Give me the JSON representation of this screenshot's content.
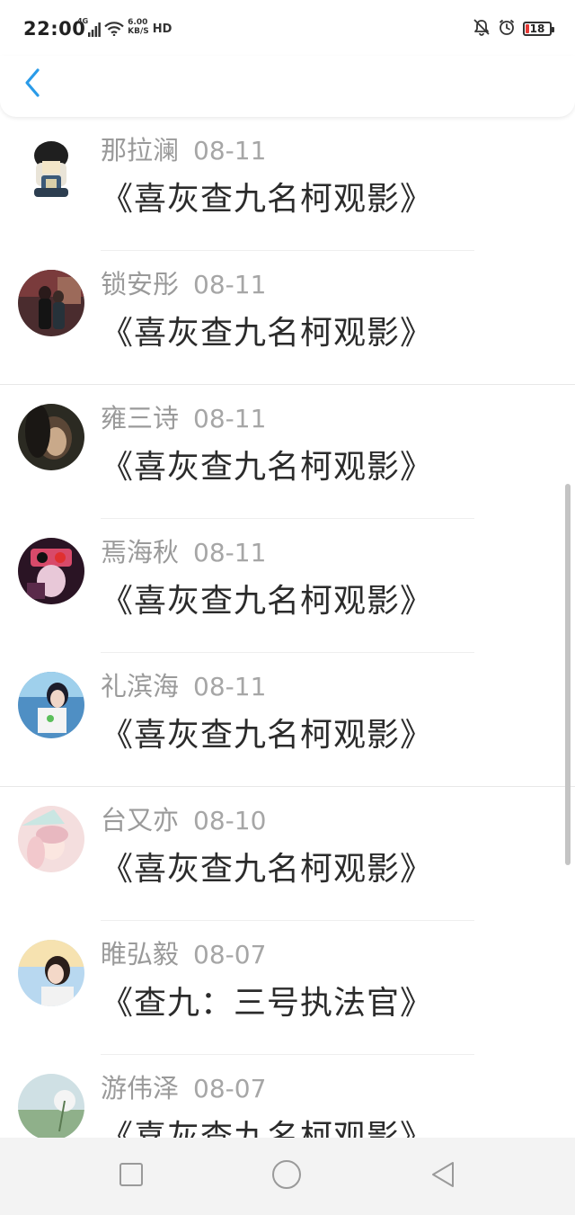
{
  "status_bar": {
    "time": "22:00",
    "network_type": "4G",
    "speed_value": "6.00",
    "speed_unit": "KB/S",
    "hd_label": "HD",
    "battery_level": "18",
    "icons": [
      "signal-icon",
      "wifi-icon",
      "bell-muted-icon",
      "alarm-clock-icon",
      "battery-icon"
    ],
    "battery_color": "#e53935"
  },
  "header": {
    "back_icon": "chevron-left-icon",
    "accent_color": "#2a9be8"
  },
  "list": {
    "items": [
      {
        "name": "那拉澜",
        "date": "08-11",
        "title": "《喜灰查九名柯观影》"
      },
      {
        "name": "锁安彤",
        "date": "08-11",
        "title": "《喜灰查九名柯观影》"
      },
      {
        "name": "雍三诗",
        "date": "08-11",
        "title": "《喜灰查九名柯观影》"
      },
      {
        "name": "焉海秋",
        "date": "08-11",
        "title": "《喜灰查九名柯观影》"
      },
      {
        "name": "礼滨海",
        "date": "08-11",
        "title": "《喜灰查九名柯观影》"
      },
      {
        "name": "台又亦",
        "date": "08-10",
        "title": "《喜灰查九名柯观影》"
      },
      {
        "name": "睢弘毅",
        "date": "08-07",
        "title": "《查九：三号执法官》"
      },
      {
        "name": "游伟泽",
        "date": "08-07",
        "title": "《喜灰查九名柯观影》"
      }
    ]
  },
  "system_nav": {
    "icons": [
      "recent-apps-icon",
      "home-icon",
      "back-triangle-icon"
    ]
  }
}
